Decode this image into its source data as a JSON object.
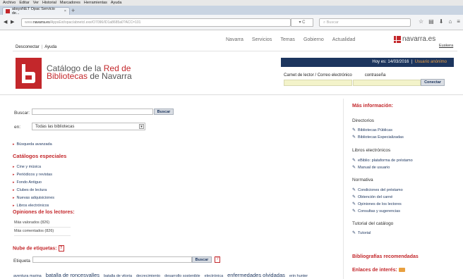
{
  "browser": {
    "menu": [
      "Archivo",
      "Editar",
      "Ver",
      "Historial",
      "Marcadores",
      "Herramientas",
      "Ayuda"
    ],
    "tab_title": "absysNET Opac Servicio de...",
    "url_prefix": "www.",
    "url_host": "navarra.es",
    "url_path": "/AppsExt/opac/abnetcl.exe/O7096/ID1a8685a0?ACC=101",
    "search_placeholder": "Buscar"
  },
  "site": {
    "desconectar": "Desconectar",
    "ayuda": "Ayuda",
    "menu": [
      "Navarra",
      "Servicios",
      "Temas",
      "Gobierno",
      "Actualidad"
    ],
    "brand": "navarra.es",
    "euskera": "Euskera",
    "colors": {
      "accent": "#c3272b",
      "navy": "#1c355e",
      "highlight": "#f0a040",
      "field": "#f3f3ca"
    }
  },
  "header": {
    "logo_line1_a": "Catálogo de la ",
    "logo_line1_b": "Red de",
    "logo_line2_a": "Bibliotecas",
    "logo_line2_b": " de Navarra",
    "date_text": "Hoy es: 14/03/2016",
    "user_text": "Usuario anónimo",
    "user_label": "Carnet de lector / Correo electrónico",
    "pass_label": "contraseña",
    "connect_button": "Conectar"
  },
  "search": {
    "label": "Buscar:",
    "button": "Buscar",
    "in_label": "en:",
    "library_selected": "Todas las bibliotecas",
    "advanced": "Búsqueda avanzada"
  },
  "special": {
    "title": "Catálogos especiales",
    "items": [
      "Cine y música",
      "Periódicos y revistas",
      "Fondo Antiguo",
      "Clubes de lectura",
      "Nuevas adquisiciones",
      "Libros electrónicos"
    ]
  },
  "opinions": {
    "title": "Opiniones de los lectores:",
    "items": [
      "Más valorados (826)",
      "Más comentados (826)"
    ]
  },
  "tags": {
    "title": "Nube de etiquetas:",
    "label": "Etiqueta",
    "button": "Buscar",
    "cloud": [
      "aventura marina",
      "batalla de roncesvalles",
      "batalla de vitoria",
      "decrecimiento",
      "desarrollo sostenible",
      "electrónica",
      "enfermedades olvidadas",
      "erin hunter"
    ]
  },
  "right": {
    "mas_info": "Más información:",
    "directorios": "Directorios",
    "dir_items": [
      "Bibliotecas Públicas",
      "Bibliotecas Especializadas"
    ],
    "libros": "Libros electrónicos",
    "libros_items": [
      "eBiblio: plataforma de préstamo",
      "Manual de usuario"
    ],
    "normativa": "Normativa",
    "norm_items": [
      "Condiciones del préstamo",
      "Obtención del carné",
      "Opiniones de los lectores",
      "Consultas y sugerencias"
    ],
    "tutorial": "Tutorial del catálogo",
    "tutorial_items": [
      "Tutorial"
    ],
    "bibliografias": "Bibliografías recomendadas",
    "enlaces": "Enlaces de interés:"
  }
}
